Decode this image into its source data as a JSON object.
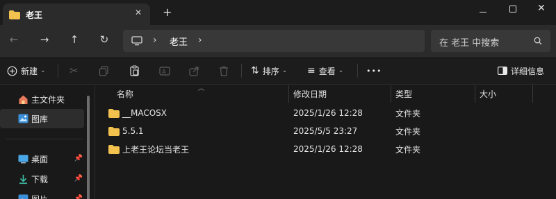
{
  "window": {
    "tab_title": "老王",
    "tab_close": "✕",
    "new_tab": "+"
  },
  "nav": {
    "path_segment": "老王",
    "search_placeholder": "在 老王 中搜索"
  },
  "commands": {
    "new_label": "新建",
    "sort_label": "排序",
    "view_label": "查看",
    "more_label": "•••",
    "details_label": "详细信息"
  },
  "sidebar": {
    "items": [
      {
        "label": "主文件夹",
        "icon": "home-icon"
      },
      {
        "label": "图库",
        "icon": "gallery-icon"
      },
      {
        "label": "桌面",
        "icon": "desktop-icon"
      },
      {
        "label": "下载",
        "icon": "download-icon"
      },
      {
        "label": "图片",
        "icon": "pictures-icon"
      }
    ]
  },
  "columns": {
    "name": "名称",
    "modified": "修改日期",
    "type": "类型",
    "size": "大小"
  },
  "files": [
    {
      "name": "__MACOSX",
      "modified": "2025/1/26 12:28",
      "type": "文件夹",
      "size": ""
    },
    {
      "name": "5.5.1",
      "modified": "2025/5/5 23:27",
      "type": "文件夹",
      "size": ""
    },
    {
      "name": "上老王论坛当老王",
      "modified": "2025/1/26 12:28",
      "type": "文件夹",
      "size": ""
    }
  ],
  "colors": {
    "folder": "#f2c14e",
    "background": "#191919",
    "toolbar": "#2b2b2b",
    "accent": "#4cc2ff"
  }
}
